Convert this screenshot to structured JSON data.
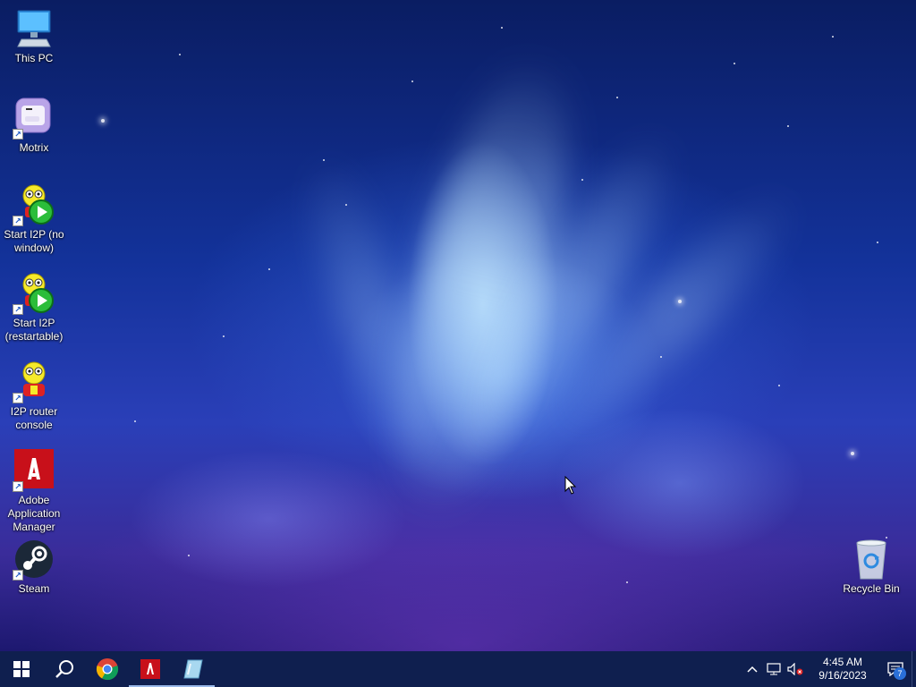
{
  "desktop_icons": [
    {
      "label": "This PC",
      "icon": "computer-icon"
    },
    {
      "label": "Motrix",
      "icon": "motrix-icon"
    },
    {
      "label": "Start I2P (no window)",
      "icon": "i2p-start-icon"
    },
    {
      "label": "Start I2P (restartable)",
      "icon": "i2p-start-icon"
    },
    {
      "label": "I2P router console",
      "icon": "i2p-icon"
    },
    {
      "label": "Adobe Application Manager",
      "icon": "adobe-icon"
    },
    {
      "label": "Steam",
      "icon": "steam-icon"
    },
    {
      "label": "Recycle Bin",
      "icon": "recycle-bin-icon"
    }
  ],
  "taskbar": {
    "pinned": [
      "start-icon",
      "search-icon",
      "chrome-icon",
      "adobe-icon",
      "glass-app-icon"
    ]
  },
  "tray": {
    "time": "4:45 AM",
    "date": "9/16/2023",
    "notification_count": "7"
  }
}
